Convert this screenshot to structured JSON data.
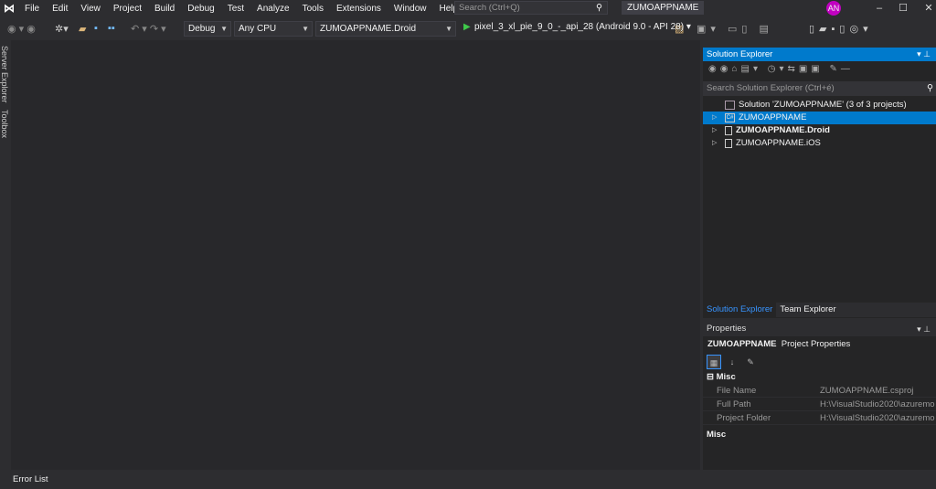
{
  "menu": [
    "File",
    "Edit",
    "View",
    "Project",
    "Build",
    "Debug",
    "Test",
    "Analyze",
    "Tools",
    "Extensions",
    "Window",
    "Help"
  ],
  "search_placeholder": "Search (Ctrl+Q)",
  "window_title": "ZUMOAPPNAME",
  "avatar": "AN",
  "toolbar": {
    "config": "Debug",
    "platform": "Any CPU",
    "startup_project": "ZUMOAPPNAME.Droid",
    "run_target": "pixel_3_xl_pie_9_0_-_api_28 (Android 9.0 - API 28)"
  },
  "side_tabs": [
    "Server Explorer",
    "Toolbox"
  ],
  "bottom_tab": "Error List",
  "solution_explorer": {
    "title": "Solution Explorer",
    "search_placeholder": "Search Solution Explorer (Ctrl+é)",
    "solution": "Solution 'ZUMOAPPNAME' (3 of 3 projects)",
    "projects": [
      "ZUMOAPPNAME",
      "ZUMOAPPNAME.Droid",
      "ZUMOAPPNAME.iOS"
    ]
  },
  "panel_tabs": [
    "Solution Explorer",
    "Team Explorer"
  ],
  "properties": {
    "title": "Properties",
    "object": "ZUMOAPPNAME",
    "object_type": "Project Properties",
    "category": "Misc",
    "rows": [
      {
        "k": "File Name",
        "v": "ZUMOAPPNAME.csproj"
      },
      {
        "k": "Full Path",
        "v": "H:\\VisualStudio2020\\azuremo"
      },
      {
        "k": "Project Folder",
        "v": "H:\\VisualStudio2020\\azuremo"
      }
    ],
    "desc_title": "Misc"
  },
  "colors": {
    "accent": "#007acc",
    "run": "#3fc94a"
  }
}
